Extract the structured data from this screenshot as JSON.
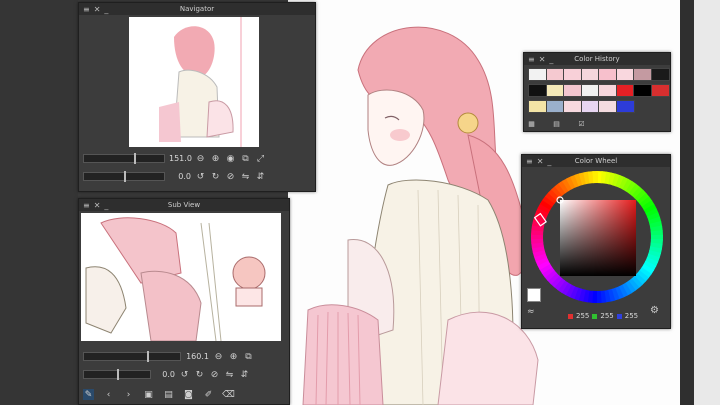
{
  "navigator": {
    "title": "Navigator",
    "zoom_value": "151.0",
    "rotation_value": "0.0",
    "zoom_level": 0.62,
    "rotation_level": 0.5
  },
  "subview": {
    "title": "Sub View",
    "zoom_value": "160.1",
    "rotation_value": "0.0",
    "zoom_level": 0.66,
    "rotation_level": 0.5
  },
  "color_history": {
    "title": "Color History",
    "swatches": [
      "#f2f2f2",
      "#f5c9d0",
      "#f8d0d8",
      "#f4d6dc",
      "#f7c0cc",
      "#f9d7de",
      "#c49aa1",
      "#1a1a1a",
      "#111111",
      "#f5e9b8",
      "#f3c6cf",
      "#f1f1f1",
      "#f7d6dc",
      "#e52025",
      "#000000",
      "#d72f2f",
      "#f3e4a6",
      "#9ab0cc",
      "#f7d9df",
      "#e8d6f2",
      "#f4dce0",
      "#2d3cd8"
    ]
  },
  "color_wheel": {
    "title": "Color Wheel",
    "r": "255",
    "g": "255",
    "b": "255",
    "current_color": "#ffffff"
  },
  "icons": [
    "close-icon",
    "minimize-icon",
    "menu-icon",
    "eyedropper-icon",
    "rotate-left-icon",
    "rotate-right-icon",
    "flip-horizontal-icon",
    "flip-vertical-icon",
    "fit-icon",
    "camera-icon"
  ]
}
